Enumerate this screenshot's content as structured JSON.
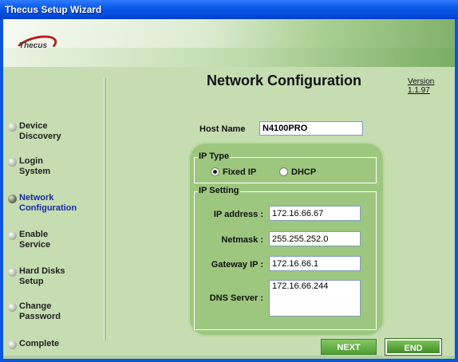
{
  "window": {
    "title": "Thecus Setup Wizard"
  },
  "banner": {
    "logo_text": "Thecus"
  },
  "sidebar": {
    "steps": [
      {
        "label": "Device\nDiscovery",
        "active": false
      },
      {
        "label": "Login\nSystem",
        "active": false
      },
      {
        "label": "Network\nConfiguration",
        "active": true
      },
      {
        "label": "Enable\nService",
        "active": false
      },
      {
        "label": "Hard Disks\nSetup",
        "active": false
      },
      {
        "label": "Change\nPassword",
        "active": false
      },
      {
        "label": "Complete",
        "active": false
      }
    ]
  },
  "main": {
    "heading": "Network Configuration",
    "version": "Version 1.1.97",
    "host_name_label": "Host Name",
    "host_name_value": "N4100PRO",
    "ip_type": {
      "title": "IP Type",
      "options": [
        {
          "label": "Fixed IP",
          "selected": true
        },
        {
          "label": "DHCP",
          "selected": false
        }
      ]
    },
    "ip_setting": {
      "title": "IP Setting",
      "ip_address_label": "IP address :",
      "ip_address_value": "172.16.66.67",
      "netmask_label": "Netmask :",
      "netmask_value": "255.255.252.0",
      "gateway_label": "Gateway IP :",
      "gateway_value": "172.16.66.1",
      "dns_label": "DNS Server :",
      "dns_value": "172.16.66.244"
    },
    "buttons": {
      "next": "NEXT",
      "end": "END"
    }
  },
  "colors": {
    "panel": "#9dc77e",
    "background": "#c6ddb2",
    "title_bar": "#0a55e0"
  },
  "icons": {
    "step_bullet": "sphere-bullet-icon",
    "logo": "thecus-logo-icon"
  }
}
